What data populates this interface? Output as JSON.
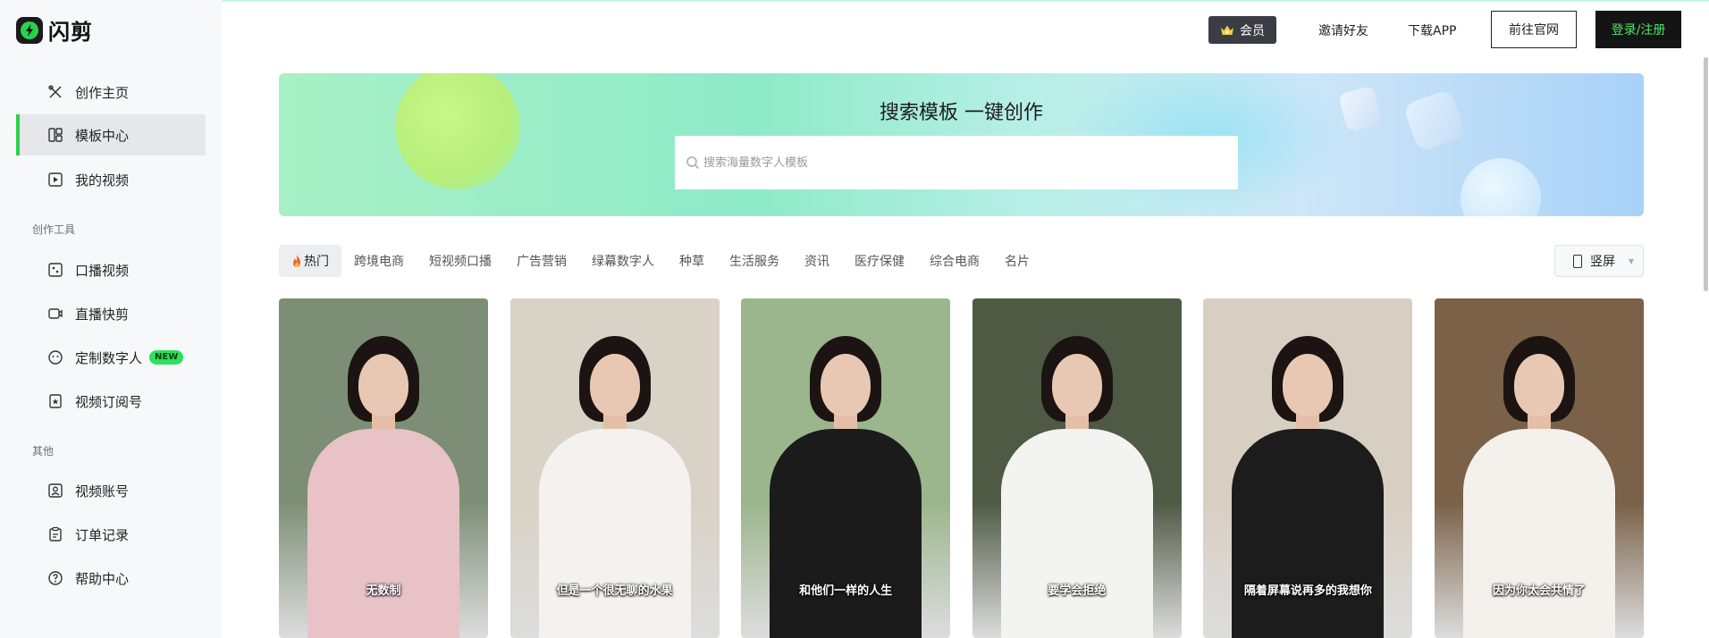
{
  "app": {
    "name": "闪剪"
  },
  "sidebar": {
    "main_items": [
      {
        "label": "创作主页",
        "icon": "create-icon"
      },
      {
        "label": "模板中心",
        "icon": "template-icon",
        "active": true
      },
      {
        "label": "我的视频",
        "icon": "video-icon"
      }
    ],
    "section_tools": "创作工具",
    "tool_items": [
      {
        "label": "口播视频",
        "icon": "talking-video-icon"
      },
      {
        "label": "直播快剪",
        "icon": "live-clip-icon"
      },
      {
        "label": "定制数字人",
        "icon": "avatar-face-icon",
        "badge": "NEW"
      },
      {
        "label": "视频订阅号",
        "icon": "subscription-icon"
      }
    ],
    "section_other": "其他",
    "other_items": [
      {
        "label": "视频账号",
        "icon": "account-icon"
      },
      {
        "label": "订单记录",
        "icon": "order-icon"
      },
      {
        "label": "帮助中心",
        "icon": "help-icon"
      }
    ]
  },
  "header": {
    "vip_label": "会员",
    "invite_label": "邀请好友",
    "download_label": "下载APP",
    "official_site_label": "前往官网",
    "login_label": "登录/注册"
  },
  "banner": {
    "title": "搜索模板 一键创作",
    "search_placeholder": "搜索海量数字人模板"
  },
  "tabs": [
    {
      "label": "热门",
      "active": true
    },
    {
      "label": "跨境电商"
    },
    {
      "label": "短视频口播"
    },
    {
      "label": "广告营销"
    },
    {
      "label": "绿幕数字人"
    },
    {
      "label": "种草"
    },
    {
      "label": "生活服务"
    },
    {
      "label": "资讯"
    },
    {
      "label": "医疗保健"
    },
    {
      "label": "综合电商"
    },
    {
      "label": "名片"
    }
  ],
  "orientation_select": {
    "value": "竖屏"
  },
  "cards": [
    {
      "caption": "无数制",
      "bg": "#7c8f76",
      "outfit": "#e9c2c8"
    },
    {
      "caption": "但是一个很无聊的水果",
      "bg": "#d9d2c6",
      "outfit": "#f4f2ef"
    },
    {
      "caption": "和他们一样的人生",
      "bg": "#9bb58d",
      "outfit": "#1b1b1b"
    },
    {
      "caption": "要学会拒绝",
      "bg": "#4e5a44",
      "outfit": "#f3f3f1"
    },
    {
      "caption": "隔着屏幕说再多的我想你",
      "bg": "#d8cfc3",
      "outfit": "#1c1c1c"
    },
    {
      "caption": "因为你太会共情了",
      "bg": "#7a6148",
      "outfit": "#f4f1ec"
    }
  ],
  "colors": {
    "accent_green": "#2bd14e",
    "login_text": "#4fe36c",
    "sidebar_bg": "#f7f8fa"
  }
}
